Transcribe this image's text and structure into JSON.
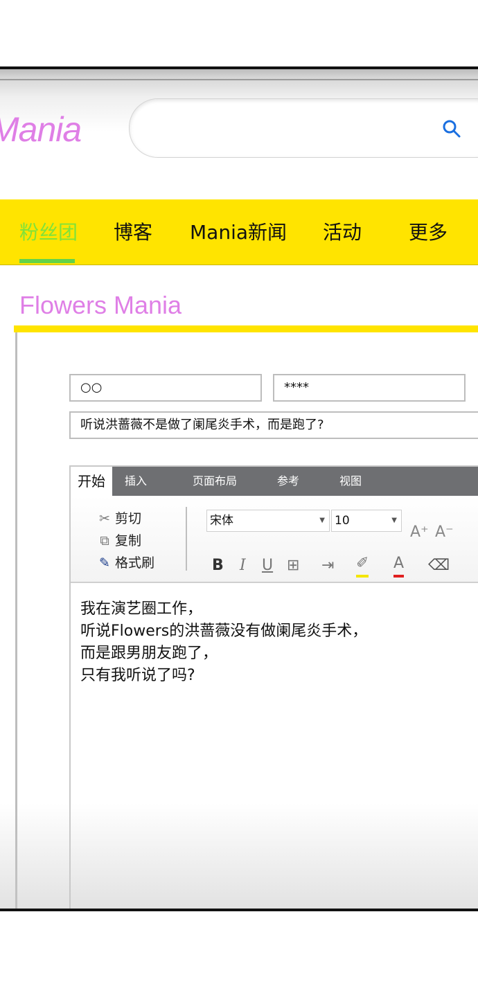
{
  "header": {
    "logo_text": "Mania",
    "search_placeholder": "",
    "search_icon": "search-icon"
  },
  "nav": {
    "items": [
      {
        "label": "粉丝团",
        "active": true
      },
      {
        "label": "博客",
        "active": false
      },
      {
        "label": "Mania新闻",
        "active": false
      },
      {
        "label": "活动",
        "active": false
      },
      {
        "label": "更多",
        "active": false
      }
    ]
  },
  "page": {
    "title": "Flowers Mania"
  },
  "form": {
    "name_value": "○○",
    "password_value": "****",
    "subject_value": "听说洪蔷薇不是做了阑尾炎手术，而是跑了?"
  },
  "ribbon": {
    "tabs": [
      "开始",
      "插入",
      "页面布局",
      "参考",
      "视图"
    ],
    "clipboard": {
      "cut": "剪切",
      "copy": "复制",
      "format_painter": "格式刷"
    },
    "font_name": "宋体",
    "font_size": "10",
    "tools": [
      "bold-icon",
      "italic-icon",
      "underline-icon",
      "border-icon",
      "indent-icon",
      "highlight-icon",
      "font-color-icon",
      "eraser-icon"
    ],
    "grow_font": "A⁺",
    "shrink_font": "A⁻"
  },
  "editor": {
    "lines": [
      "我在演艺圈工作，",
      "听说Flowers的洪蔷薇没有做阑尾炎手术，",
      "而是跟男朋友跑了，",
      "只有我听说了吗?"
    ]
  },
  "colors": {
    "accent_yellow": "#ffe400",
    "brand_pink": "#df7fe6",
    "nav_active_green": "#7fe23a",
    "highlight_yellow": "#f4e600",
    "font_color_red": "#e02020"
  }
}
